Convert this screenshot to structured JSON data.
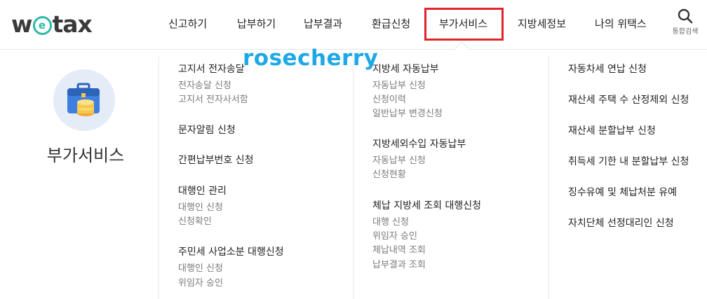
{
  "logo": {
    "pre": "w",
    "circle": "e",
    "post": "tax"
  },
  "nav": [
    {
      "label": "신고하기"
    },
    {
      "label": "납부하기"
    },
    {
      "label": "납부결과"
    },
    {
      "label": "환급신청"
    },
    {
      "label": "부가서비스"
    },
    {
      "label": "지방세정보"
    },
    {
      "label": "나의 위택스"
    }
  ],
  "search": {
    "label": "통합검색",
    "icon": "search-icon"
  },
  "side": {
    "title": "부가서비스",
    "icon": "toolbox-coins-icon"
  },
  "columns": [
    {
      "groups": [
        {
          "title": "고지서 전자송달",
          "items": [
            "전자송달 신청",
            "고지서 전자사서함"
          ]
        },
        {
          "title": "문자알림 신청",
          "items": []
        },
        {
          "title": "간편납부번호 신청",
          "items": []
        },
        {
          "title": "대행인 관리",
          "items": [
            "대행인 신청",
            "신청확인"
          ]
        },
        {
          "title": "주민세 사업소분 대행신청",
          "items": [
            "대행인 신청",
            "위임자 승인"
          ]
        }
      ]
    },
    {
      "groups": [
        {
          "title": "지방세 자동납부",
          "items": [
            "자동납부 신청",
            "신청이력",
            "일반납부 변경신청"
          ]
        },
        {
          "title": "지방세외수입 자동납부",
          "items": [
            "자동납부 신청",
            "신청현황"
          ]
        },
        {
          "title": "체납 지방세 조회 대행신청",
          "items": [
            "대행 신청",
            "위임자 승인",
            "체납내역 조회",
            "납부결과 조회"
          ]
        }
      ]
    },
    {
      "groups": [
        {
          "title": "자동차세 연납 신청",
          "items": []
        },
        {
          "title": "재산세 주택 수 산정제외 신청",
          "items": []
        },
        {
          "title": "재산세 분할납부 신청",
          "items": []
        },
        {
          "title": "취득세 기한 내 분할납부 신청",
          "items": []
        },
        {
          "title": "징수유예 및 체납처분 유예",
          "items": []
        },
        {
          "title": "자치단체 선정대리인 신청",
          "items": []
        }
      ]
    }
  ],
  "watermark": "rosecherry",
  "colors": {
    "highlight": "#e0242b",
    "logo_accent": "#2fb8a6",
    "watermark": "#1fa8e6",
    "icon_bg": "#e4ecf8"
  }
}
